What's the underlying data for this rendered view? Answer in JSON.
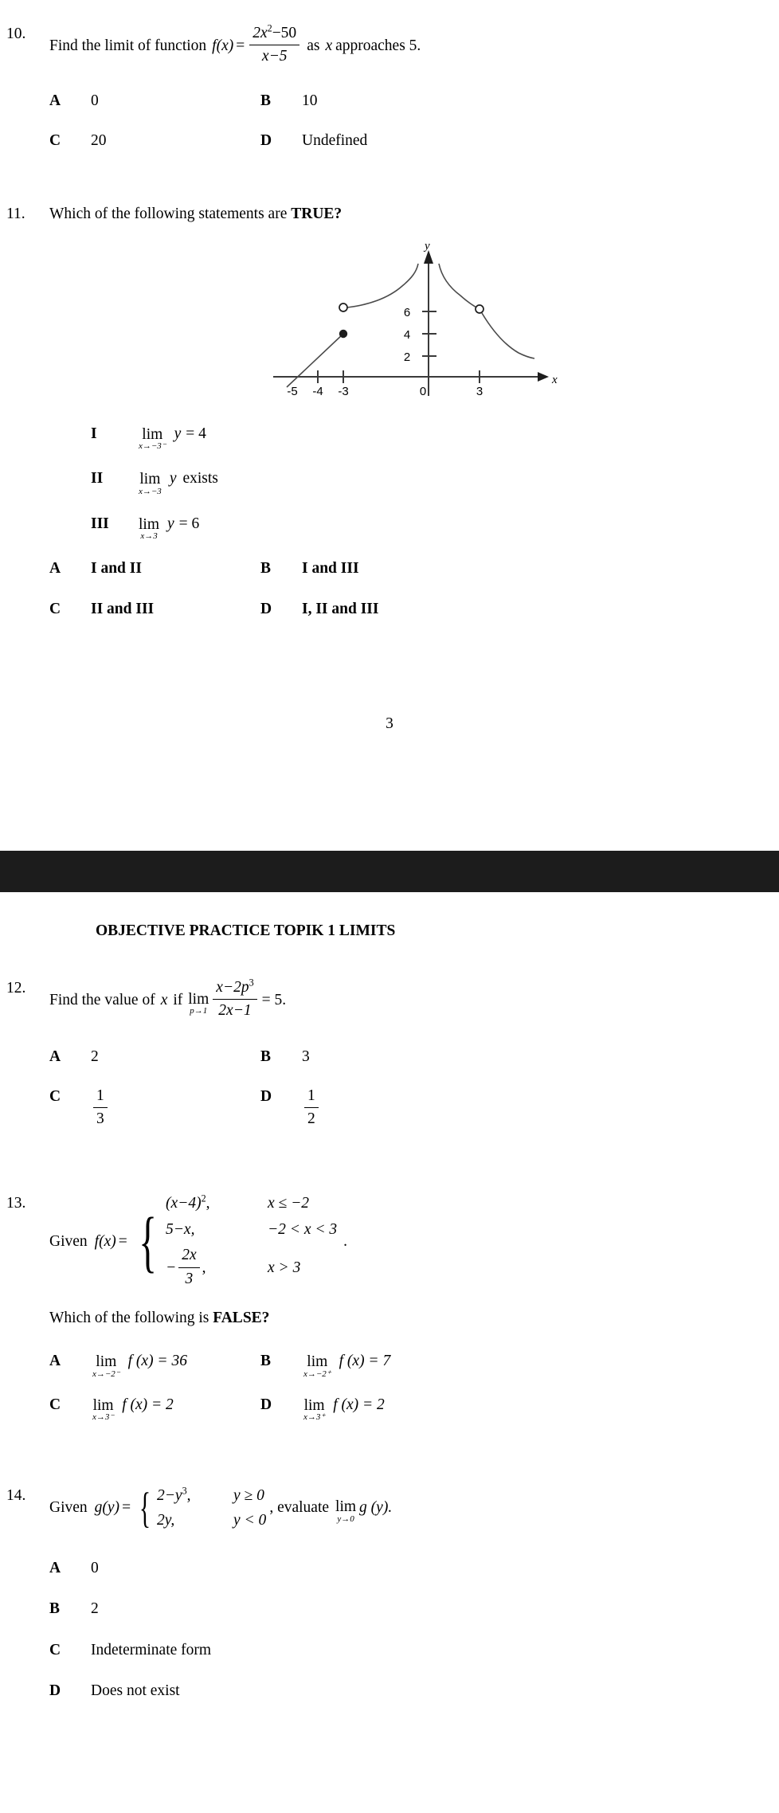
{
  "doc": {
    "header_title": "OBJECTIVE PRACTICE TOPIK 1 LIMITS",
    "page_number": "3"
  },
  "q10": {
    "number": "10.",
    "stem_before": "Find the limit of function",
    "fn_lhs": "f",
    "fn_arg": "(x)",
    "equals": "=",
    "numerator_a": "2x",
    "numerator_exp": "2",
    "numerator_b": "−50",
    "denominator": "x−5",
    "stem_after_1": "as",
    "stem_after_var": "x",
    "stem_after_2": "approaches 5.",
    "options": [
      {
        "letter": "A",
        "text": "0"
      },
      {
        "letter": "B",
        "text": "10"
      },
      {
        "letter": "C",
        "text": "20"
      },
      {
        "letter": "D",
        "text": "Undefined"
      }
    ]
  },
  "q11": {
    "number": "11.",
    "stem_plain": "Which of the following statements are ",
    "stem_bold": "TRUE?",
    "statements": [
      {
        "roman": "I",
        "lim_main": "lim",
        "lim_sub": "x→−3⁻",
        "body_var": "y",
        "body_rest": "= 4"
      },
      {
        "roman": "II",
        "lim_main": "lim",
        "lim_sub": "x→−3",
        "body_var": "y",
        "body_rest": "exists"
      },
      {
        "roman": "III",
        "lim_main": "lim",
        "lim_sub": "x→3",
        "body_var": "y",
        "body_rest": "= 6"
      }
    ],
    "options": [
      {
        "letter": "A",
        "text": "I and II"
      },
      {
        "letter": "B",
        "text": "I and III"
      },
      {
        "letter": "C",
        "text": "II and III"
      },
      {
        "letter": "D",
        "text": "I, II and III"
      }
    ]
  },
  "chart_data": {
    "type": "line",
    "title": "",
    "xlabel": "x",
    "ylabel": "y",
    "xlim": [
      -6,
      5.2
    ],
    "ylim": [
      -1.2,
      10.5
    ],
    "x_ticks": [
      -5,
      -4,
      -3,
      0,
      3
    ],
    "x_tick_labels": [
      "-5",
      "-4",
      "-3",
      "0",
      "3"
    ],
    "y_ticks": [
      2,
      4,
      6
    ],
    "y_tick_labels": [
      "2",
      "4",
      "6"
    ],
    "grid": false,
    "legend": false,
    "axis_arrows": [
      "x-right",
      "y-up"
    ],
    "series": [
      {
        "name": "linear-segment",
        "type": "line",
        "points": [
          [
            -5.2,
            -0.4
          ],
          [
            -3,
            4
          ]
        ],
        "end_marker": "filled-circle",
        "end_point": [
          -3,
          4
        ]
      },
      {
        "name": "left-branch-asymptotic",
        "type": "curve",
        "points": [
          [
            -3,
            6.3
          ],
          [
            -2.4,
            6.5
          ],
          [
            -1.8,
            6.9
          ],
          [
            -1.2,
            7.6
          ],
          [
            -0.75,
            8.4
          ],
          [
            -0.45,
            9.2
          ],
          [
            -0.3,
            10.0
          ]
        ],
        "start_marker": "open-circle",
        "start_point": [
          -3,
          6.3
        ],
        "asymptote": "x=0 (left side, y→∞)"
      },
      {
        "name": "right-branch-asymptotic",
        "type": "curve",
        "points": [
          [
            0.3,
            10.0
          ],
          [
            0.5,
            9.0
          ],
          [
            0.8,
            8.2
          ],
          [
            1.3,
            7.4
          ],
          [
            1.9,
            6.8
          ],
          [
            2.5,
            6.4
          ],
          [
            3,
            6.2
          ]
        ],
        "end_marker": "open-circle",
        "end_point": [
          3,
          6.2
        ],
        "asymptote": "x=0 (right side, y→∞)"
      },
      {
        "name": "right-tail",
        "type": "curve",
        "points": [
          [
            3,
            6.2
          ],
          [
            3.3,
            5.2
          ],
          [
            3.7,
            4.2
          ],
          [
            4.1,
            3.4
          ],
          [
            4.6,
            2.7
          ],
          [
            5.0,
            2.4
          ]
        ],
        "start_marker": "none"
      }
    ],
    "markers": [
      {
        "kind": "filled-circle",
        "x": -3,
        "y": 4
      },
      {
        "kind": "open-circle",
        "x": -3,
        "y": 6.3
      },
      {
        "kind": "open-circle",
        "x": 3,
        "y": 6.2
      }
    ]
  },
  "q12": {
    "number": "12.",
    "stem_1": "Find the value of",
    "stem_var": "x",
    "stem_2": "if",
    "lim_main": "lim",
    "lim_sub": "p→1",
    "numerator_a": "x−2p",
    "numerator_exp": "3",
    "denominator": "2x−1",
    "rhs": "= 5.",
    "options": [
      {
        "letter": "A",
        "text": "2",
        "frac": null
      },
      {
        "letter": "B",
        "text": "3",
        "frac": null
      },
      {
        "letter": "C",
        "text": null,
        "frac": {
          "num": "1",
          "den": "3"
        }
      },
      {
        "letter": "D",
        "text": null,
        "frac": {
          "num": "1",
          "den": "2"
        }
      }
    ]
  },
  "q13": {
    "number": "13.",
    "stem": "Given",
    "fn_lhs": "f",
    "fn_arg": "(x)",
    "equals": "=",
    "pieces": [
      {
        "expr_a": "(x−4)",
        "expr_exp": "2",
        "expr_b": ",",
        "cond": "x ≤ −2",
        "frac": null
      },
      {
        "expr_a": "5−x,",
        "expr_exp": "",
        "expr_b": "",
        "cond": "−2 < x < 3",
        "frac": null
      },
      {
        "expr_a": "−",
        "expr_exp": "",
        "expr_b": ",",
        "cond": "x > 3",
        "frac": {
          "num": "2x",
          "den": "3"
        }
      }
    ],
    "trailing_period": ".",
    "subquestion_plain": "Which of the following is ",
    "subquestion_bold": "FALSE?",
    "options": [
      {
        "letter": "A",
        "lim_main": "lim",
        "lim_sub": "x→−2⁻",
        "body": "f (x) = 36"
      },
      {
        "letter": "B",
        "lim_main": "lim",
        "lim_sub": "x→−2⁺",
        "body": "f (x) = 7"
      },
      {
        "letter": "C",
        "lim_main": "lim",
        "lim_sub": "x→3⁻",
        "body": "f (x) = 2"
      },
      {
        "letter": "D",
        "lim_main": "lim",
        "lim_sub": "x→3⁺",
        "body": "f (x) = 2"
      }
    ]
  },
  "q14": {
    "number": "14.",
    "stem": "Given",
    "fn_lhs": "g",
    "fn_arg": "(y)",
    "equals": "=",
    "pieces": [
      {
        "expr_a": "2−y",
        "expr_exp": "3",
        "expr_b": ",",
        "cond": "y ≥ 0"
      },
      {
        "expr_a": "2y,",
        "expr_exp": "",
        "expr_b": "",
        "cond": "y < 0"
      }
    ],
    "stem_after": ", evaluate",
    "lim_main": "lim",
    "lim_sub": "y→0",
    "lim_body": "g (y).",
    "options": [
      {
        "letter": "A",
        "text": "0"
      },
      {
        "letter": "B",
        "text": "2"
      },
      {
        "letter": "C",
        "text": "Indeterminate form"
      },
      {
        "letter": "D",
        "text": "Does not exist"
      }
    ]
  }
}
